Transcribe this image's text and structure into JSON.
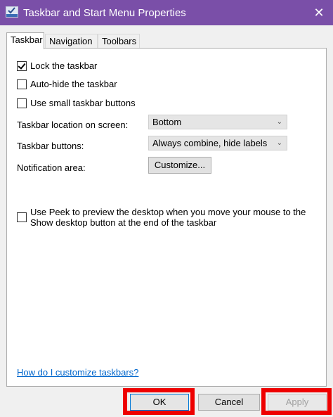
{
  "window": {
    "title": "Taskbar and Start Menu Properties",
    "title_bar_color": "#7a4fa8"
  },
  "tabs": [
    {
      "label": "Taskbar",
      "active": true
    },
    {
      "label": "Navigation",
      "active": false
    },
    {
      "label": "Toolbars",
      "active": false
    }
  ],
  "taskbar": {
    "lock": {
      "label": "Lock the taskbar",
      "checked": true
    },
    "autohide": {
      "label": "Auto-hide the taskbar",
      "checked": false
    },
    "small_buttons": {
      "label": "Use small taskbar buttons",
      "checked": false
    },
    "location": {
      "label": "Taskbar location on screen:",
      "value": "Bottom"
    },
    "buttons": {
      "label": "Taskbar buttons:",
      "value": "Always combine, hide labels"
    },
    "notification": {
      "label": "Notification area:",
      "button": "Customize..."
    },
    "peek": {
      "label": "Use Peek to preview the desktop when you move your mouse to the Show desktop button at the end of the taskbar",
      "checked": false
    },
    "help_link": "How do I customize taskbars?"
  },
  "footer": {
    "ok": "OK",
    "cancel": "Cancel",
    "apply": "Apply"
  },
  "highlight_color": "#ee0000"
}
